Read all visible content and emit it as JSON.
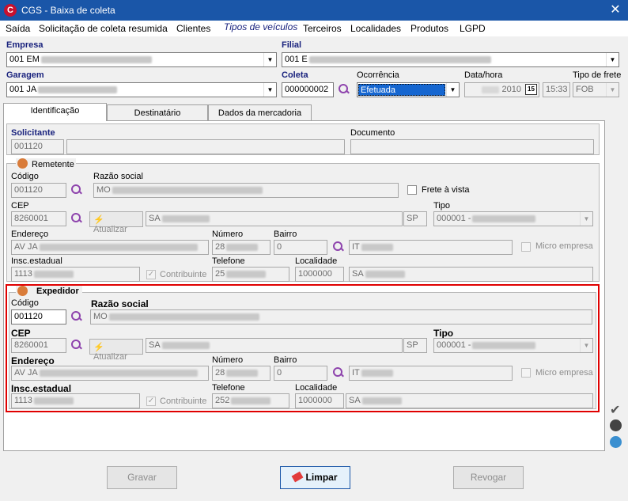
{
  "window": {
    "title": "CGS - Baixa de coleta",
    "app_icon": "C",
    "close": "✕"
  },
  "menu": [
    "Saída",
    "Solicitação de coleta resumida",
    "Clientes",
    "Tipos de veículos",
    "Terceiros",
    "Localidades",
    "Produtos",
    "LGPD"
  ],
  "header": {
    "empresa_label": "Empresa",
    "empresa_value": "001 EM",
    "filial_label": "Filial",
    "filial_value": "001 E",
    "garagem_label": "Garagem",
    "garagem_value": "001 JA",
    "coleta_label": "Coleta",
    "coleta_value": "000000002",
    "ocorrencia_label": "Ocorrência",
    "ocorrencia_value": "Efetuada",
    "datahora_label": "Data/hora",
    "data_value": "2010",
    "hora_value": "15:33",
    "calendar": "15",
    "tipofrete_label": "Tipo de frete",
    "tipofrete_value": "FOB"
  },
  "tabs": [
    "Identificação",
    "Destinatário",
    "Dados da mercadoria"
  ],
  "solicitante": {
    "label": "Solicitante",
    "codigo": "001120",
    "documento_label": "Documento"
  },
  "remetente": {
    "title": "Remetente",
    "codigo_label": "Código",
    "codigo": "001120",
    "razao_label": "Razão social",
    "razao": "MO",
    "frete_vista": "Frete à vista",
    "cep_label": "CEP",
    "cep": "8260001",
    "atualizar": "Atualizar",
    "cidade": "SA",
    "uf": "SP",
    "tipo_label": "Tipo",
    "tipo": "000001 -",
    "endereco_label": "Endereço",
    "endereco": "AV JA",
    "numero_label": "Número",
    "numero": "28",
    "bairro_label": "Bairro",
    "bairro_cod": "0",
    "bairro": "IT",
    "micro": "Micro empresa",
    "insc_label": "Insc.estadual",
    "insc": "1113",
    "contribuinte": "Contribuinte",
    "telefone_label": "Telefone",
    "telefone": "25",
    "localidade_label": "Localidade",
    "localidade_cod": "1000000",
    "localidade": "SA"
  },
  "expedidor": {
    "title": "Expedidor",
    "codigo_label": "Código",
    "codigo": "001120",
    "razao_label": "Razão social",
    "razao": "MO",
    "cep_label": "CEP",
    "cep": "8260001",
    "atualizar": "Atualizar",
    "cidade": "SA",
    "uf": "SP",
    "tipo_label": "Tipo",
    "tipo": "000001 -",
    "endereco_label": "Endereço",
    "endereco": "AV JA",
    "numero_label": "Número",
    "numero": "28",
    "bairro_label": "Bairro",
    "bairro_cod": "0",
    "bairro": "IT",
    "micro": "Micro empresa",
    "insc_label": "Insc.estadual",
    "insc": "1113",
    "contribuinte": "Contribuinte",
    "telefone_label": "Telefone",
    "telefone": "252",
    "localidade_label": "Localidade",
    "localidade_cod": "1000000",
    "localidade": "SA"
  },
  "buttons": {
    "gravar": "Gravar",
    "limpar": "Limpar",
    "revogar": "Revogar"
  },
  "colors": {
    "titlebar": "#1a56a8",
    "highlight": "#e00000",
    "menu_active": "#1a237e"
  }
}
